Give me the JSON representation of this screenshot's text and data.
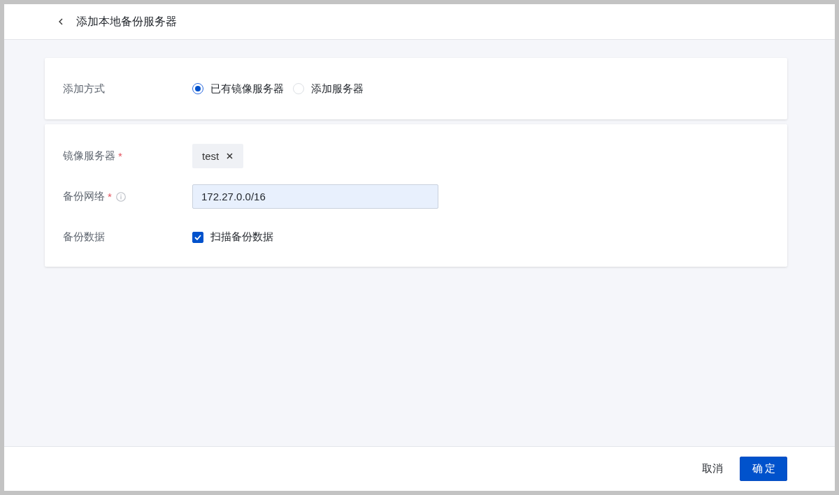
{
  "header": {
    "title": "添加本地备份服务器"
  },
  "add_method": {
    "label": "添加方式",
    "options": [
      {
        "label": "已有镜像服务器",
        "selected": true
      },
      {
        "label": "添加服务器",
        "selected": false
      }
    ]
  },
  "fields": [
    {
      "kind": "tags",
      "label": "镜像服务器",
      "required_mark": "*",
      "info": false,
      "tags": [
        "test"
      ]
    },
    {
      "kind": "input",
      "label": "备份网络",
      "required_mark": "*",
      "info": true,
      "value": "172.27.0.0/16"
    },
    {
      "kind": "checkbox",
      "label": "备份数据",
      "info": false,
      "checkbox": {
        "label": "扫描备份数据",
        "checked": true
      }
    }
  ],
  "footer": {
    "buttons": [
      {
        "kind": "text",
        "label": "取消"
      },
      {
        "kind": "primary",
        "label": "确定"
      }
    ]
  }
}
